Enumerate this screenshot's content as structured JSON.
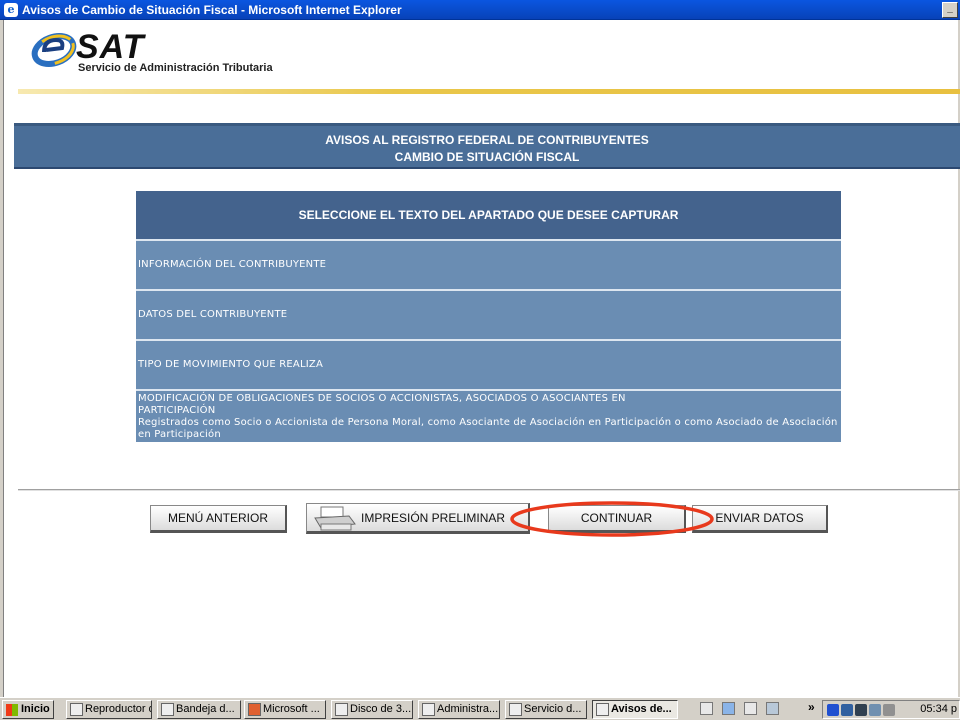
{
  "window": {
    "title": "Avisos de Cambio de Situación Fiscal - Microsoft Internet Explorer",
    "minimize": "_"
  },
  "logo": {
    "brand": "SAT",
    "subtitle": "Servicio de Administración Tributaria"
  },
  "header": {
    "line1": "AVISOS AL REGISTRO FEDERAL DE CONTRIBUYENTES",
    "line2": "CAMBIO DE SITUACIÓN FISCAL"
  },
  "panel": {
    "title": "SELECCIONE EL TEXTO DEL APARTADO QUE DESEE CAPTURAR",
    "items": [
      {
        "label": "INFORMACIÓN DEL CONTRIBUYENTE"
      },
      {
        "label": "DATOS DEL CONTRIBUYENTE"
      },
      {
        "label": "TIPO DE MOVIMIENTO QUE REALIZA"
      },
      {
        "label": "MODIFICACIÓN DE OBLIGACIONES DE SOCIOS O ACCIONISTAS, ASOCIADOS O ASOCIANTES EN PARTICIPACIÓN",
        "detail": "Registrados como Socio o Accionista de Persona Moral, como Asociante de Asociación en Participación o como Asociado de Asociación en Participación"
      }
    ]
  },
  "buttons": {
    "menu_anterior": "MENÚ ANTERIOR",
    "impresion": "IMPRESIÓN PRELIMINAR",
    "continuar": "CONTINUAR",
    "enviar": "ENVIAR DATOS"
  },
  "taskbar": {
    "start": "Inicio",
    "tasks": [
      {
        "label": "Reproductor d..."
      },
      {
        "label": "Bandeja d..."
      },
      {
        "label": "Microsoft ..."
      },
      {
        "label": "Disco de 3..."
      },
      {
        "label": "Administra..."
      },
      {
        "label": "Servicio d..."
      },
      {
        "label": "Avisos de..."
      }
    ],
    "clock": "05:34 p",
    "overflow": "»"
  },
  "colors": {
    "header_blue": "#4a6e98",
    "row_blue": "#6a8db3",
    "highlight": "#e8391c"
  }
}
